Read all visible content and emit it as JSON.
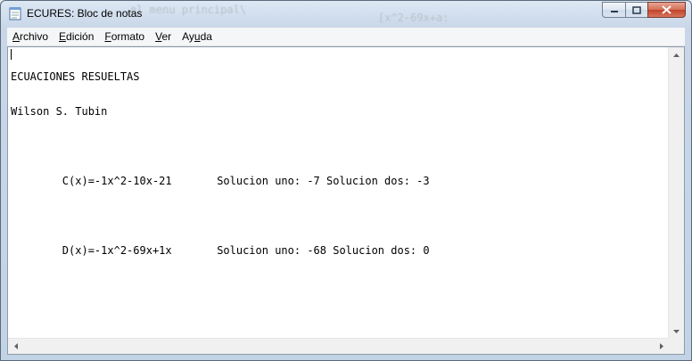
{
  "window": {
    "title": "ECURES: Bloc de notas"
  },
  "menu": [
    {
      "label_pre": "",
      "label_key": "A",
      "label_post": "rchivo"
    },
    {
      "label_pre": "",
      "label_key": "E",
      "label_post": "dición"
    },
    {
      "label_pre": "",
      "label_key": "F",
      "label_post": "ormato"
    },
    {
      "label_pre": "",
      "label_key": "V",
      "label_post": "er"
    },
    {
      "label_pre": "Ay",
      "label_key": "u",
      "label_post": "da"
    }
  ],
  "document": {
    "lines": [
      "ECUACIONES RESUELTAS",
      "Wilson S. Tubin",
      "",
      "        C(x)=-1x^2-10x-21       Solucion uno: -7 Solucion dos: -3",
      "",
      "        D(x)=-1x^2-69x+1x       Solucion uno: -68 Solucion dos: 0"
    ]
  },
  "background": {
    "ghost_1": "el menu principal\\",
    "ghost_2": "[x^2-69x+a:"
  },
  "colors": {
    "frame": "#c3d3e6",
    "close_button": "#c2432a",
    "editor_bg": "#ffffff"
  },
  "icons": {
    "app": "notepad-icon",
    "minimize": "minimize-icon",
    "maximize": "maximize-icon",
    "close": "close-icon"
  }
}
